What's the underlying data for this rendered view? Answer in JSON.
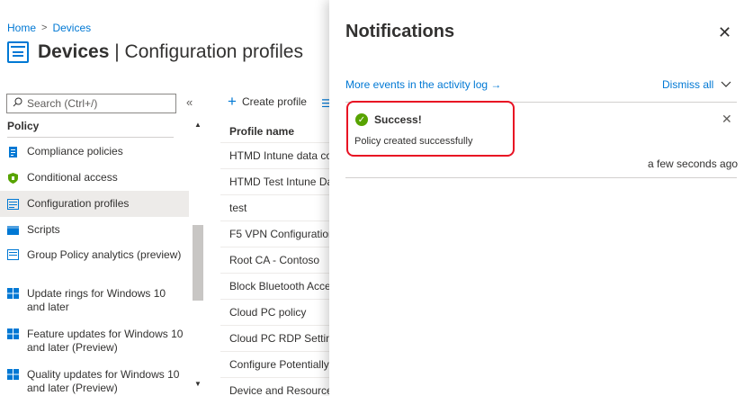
{
  "breadcrumb": {
    "home": "Home",
    "sep": ">",
    "devices": "Devices"
  },
  "page": {
    "title_bold": "Devices",
    "title_rest": " | Configuration profiles"
  },
  "search": {
    "placeholder": "Search (Ctrl+/)",
    "collapse": "«"
  },
  "sidebar": {
    "section": "Policy",
    "items": [
      {
        "label": "Compliance policies",
        "icon": "clipboard-icon"
      },
      {
        "label": "Conditional access",
        "icon": "shield-icon"
      },
      {
        "label": "Configuration profiles",
        "icon": "profile-icon",
        "active": true
      },
      {
        "label": "Scripts",
        "icon": "script-icon"
      },
      {
        "label": "Group Policy analytics (preview)",
        "icon": "analytics-icon"
      },
      {
        "label": "Update rings for Windows 10 and later",
        "icon": "windows-icon"
      },
      {
        "label": "Feature updates for Windows 10 and later (Preview)",
        "icon": "windows-icon"
      },
      {
        "label": "Quality updates for Windows 10 and later (Preview)",
        "icon": "windows-icon"
      }
    ]
  },
  "toolbar": {
    "create": "Create profile"
  },
  "table": {
    "header": "Profile name",
    "rows": [
      "HTMD Intune data co",
      "HTMD Test Intune Dat",
      "test",
      "F5 VPN Configuration",
      "Root CA - Contoso",
      "Block Bluetooth Acces",
      "Cloud PC policy",
      "Cloud PC RDP Setting",
      "Configure Potentially",
      "Device and Resource"
    ]
  },
  "notifications": {
    "title": "Notifications",
    "activity_link": "More events in the activity log →",
    "dismiss_all": "Dismiss all",
    "items": [
      {
        "title": "Success!",
        "message": "Policy created successfully",
        "time": "a few seconds ago"
      }
    ]
  },
  "colors": {
    "accent": "#0078d4",
    "success": "#57a300",
    "highlight": "#e81123"
  }
}
